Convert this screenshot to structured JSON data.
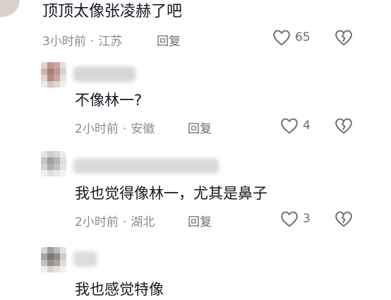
{
  "comment_top": {
    "text": "顶顶太像张凌赫了吧",
    "time": "3小时前",
    "location": "江苏",
    "reply_label": "回复",
    "like_count": "65"
  },
  "replies": [
    {
      "text": "不像林一?",
      "time": "2小时前",
      "location": "安徽",
      "reply_label": "回复",
      "like_count": "4"
    },
    {
      "text": "我也觉得像林一，尤其是鼻子",
      "time": "2小时前",
      "location": "湖北",
      "reply_label": "回复",
      "like_count": "3"
    },
    {
      "text": "我也感觉特像"
    }
  ],
  "separator": "·",
  "icons": {
    "like": "heart-outline-icon",
    "dislike": "broken-heart-icon"
  },
  "colors": {
    "text_primary": "#161823",
    "text_meta": "#8a8b91",
    "text_action": "#6d6e75"
  }
}
